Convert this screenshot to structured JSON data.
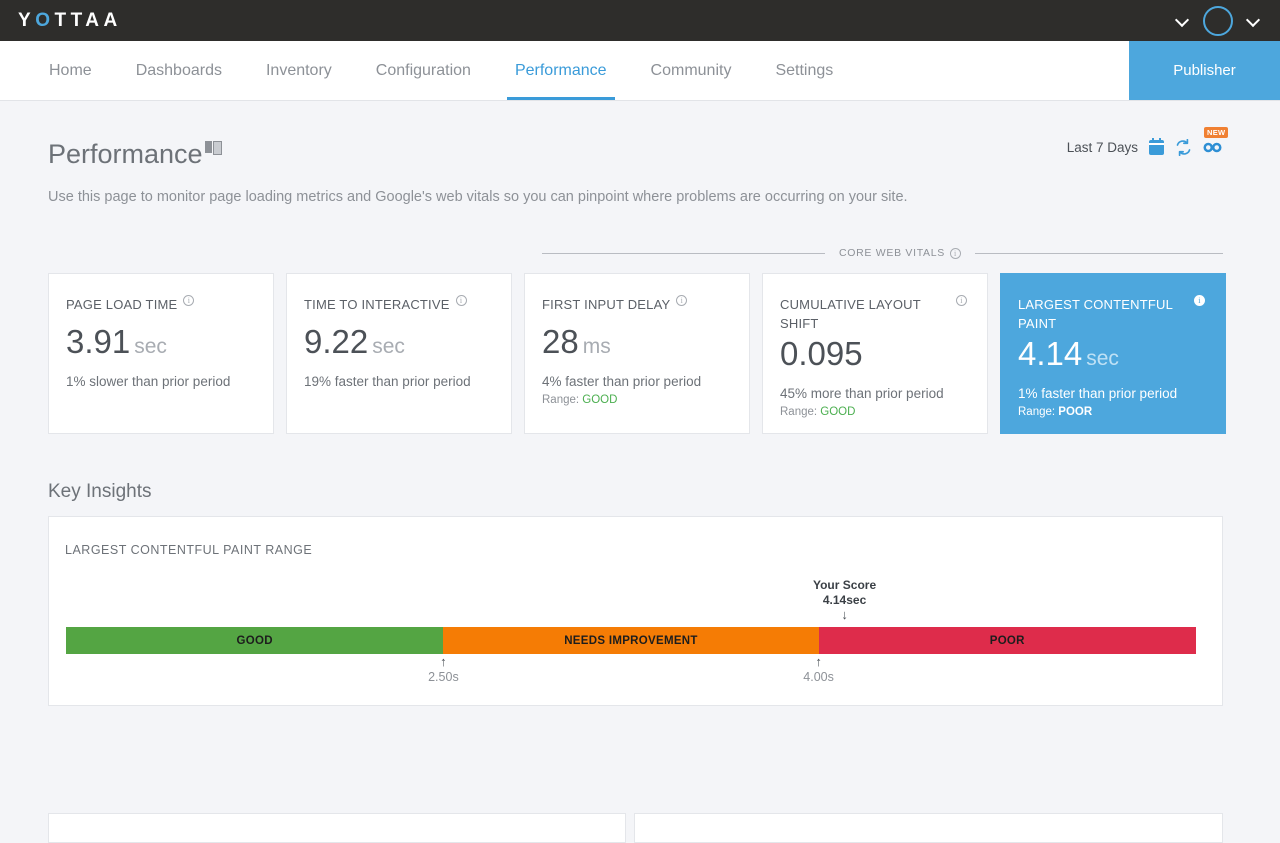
{
  "topbar": {
    "logo_y": "Y",
    "logo_o": "O",
    "logo_rest": "TTAA",
    "chevron_icon": "chevron-down-icon",
    "avatar_icon": "user-avatar-icon"
  },
  "nav": {
    "items": [
      {
        "label": "Home",
        "active": false
      },
      {
        "label": "Dashboards",
        "active": false
      },
      {
        "label": "Inventory",
        "active": false
      },
      {
        "label": "Configuration",
        "active": false
      },
      {
        "label": "Performance",
        "active": true
      },
      {
        "label": "Community",
        "active": false
      },
      {
        "label": "Settings",
        "active": false
      }
    ],
    "publisher_label": "Publisher",
    "accent_color": "#3a9bd9"
  },
  "page": {
    "title": "Performance",
    "description": "Use this page to monitor page loading metrics and Google's web vitals so you can pinpoint where problems are occurring on your site.",
    "book_icon": "book-icon"
  },
  "daterange": {
    "label": "Last 7 Days",
    "calendar_icon": "calendar-icon",
    "refresh_icon": "refresh-icon",
    "infinity_icon": "infinity-icon",
    "new_badge": "NEW"
  },
  "core_web_vitals": {
    "label": "CORE WEB VITALS",
    "info_icon": "info-icon"
  },
  "cards": [
    {
      "title": "PAGE LOAD TIME",
      "value": "3.91",
      "unit": "sec",
      "delta": "1% slower than prior period",
      "range_label": null,
      "range_value": null,
      "highlight": false
    },
    {
      "title": "TIME TO INTERACTIVE",
      "value": "9.22",
      "unit": "sec",
      "delta": "19% faster than prior period",
      "range_label": null,
      "range_value": null,
      "highlight": false
    },
    {
      "title": "FIRST INPUT DELAY",
      "value": "28",
      "unit": "ms",
      "delta": "4% faster than prior period",
      "range_label": "Range:",
      "range_value": "GOOD",
      "highlight": false
    },
    {
      "title": "CUMULATIVE LAYOUT SHIFT",
      "value": "0.095",
      "unit": "",
      "delta": "45% more than prior period",
      "range_label": "Range:",
      "range_value": "GOOD",
      "highlight": false
    },
    {
      "title": "LARGEST CONTENTFUL PAINT",
      "value": "4.14",
      "unit": "sec",
      "delta": "1% faster than prior period",
      "range_label": "Range:",
      "range_value": "POOR",
      "highlight": true
    }
  ],
  "key_insights": {
    "heading": "Key Insights",
    "panel_title": "LARGEST CONTENTFUL PAINT RANGE"
  },
  "chart_data": {
    "type": "bar",
    "title": "LARGEST CONTENTFUL PAINT RANGE",
    "xlabel": "",
    "ylabel": "",
    "orientation": "horizontal",
    "categories": [
      "GOOD",
      "NEEDS IMPROVEMENT",
      "POOR"
    ],
    "segment_colors": [
      "#54a543",
      "#f57c05",
      "#de2c4b"
    ],
    "thresholds": [
      {
        "label": "2.50s",
        "value": 2.5,
        "position_pct": 33.4
      },
      {
        "label": "4.00s",
        "value": 4.0,
        "position_pct": 66.6
      }
    ],
    "your_score": {
      "label": "Your Score",
      "value_label": "4.14sec",
      "value": 4.14,
      "position_pct": 68.9,
      "band": "POOR"
    },
    "axis_units": "seconds",
    "grid": false,
    "legend": "none"
  },
  "colors": {
    "accent": "#4da7dd",
    "good": "#54a543",
    "needs_improvement": "#f57c05",
    "poor": "#de2c4b",
    "good_text": "#4caf50",
    "badge_orange": "#f08032",
    "page_bg": "#f4f5f8"
  }
}
